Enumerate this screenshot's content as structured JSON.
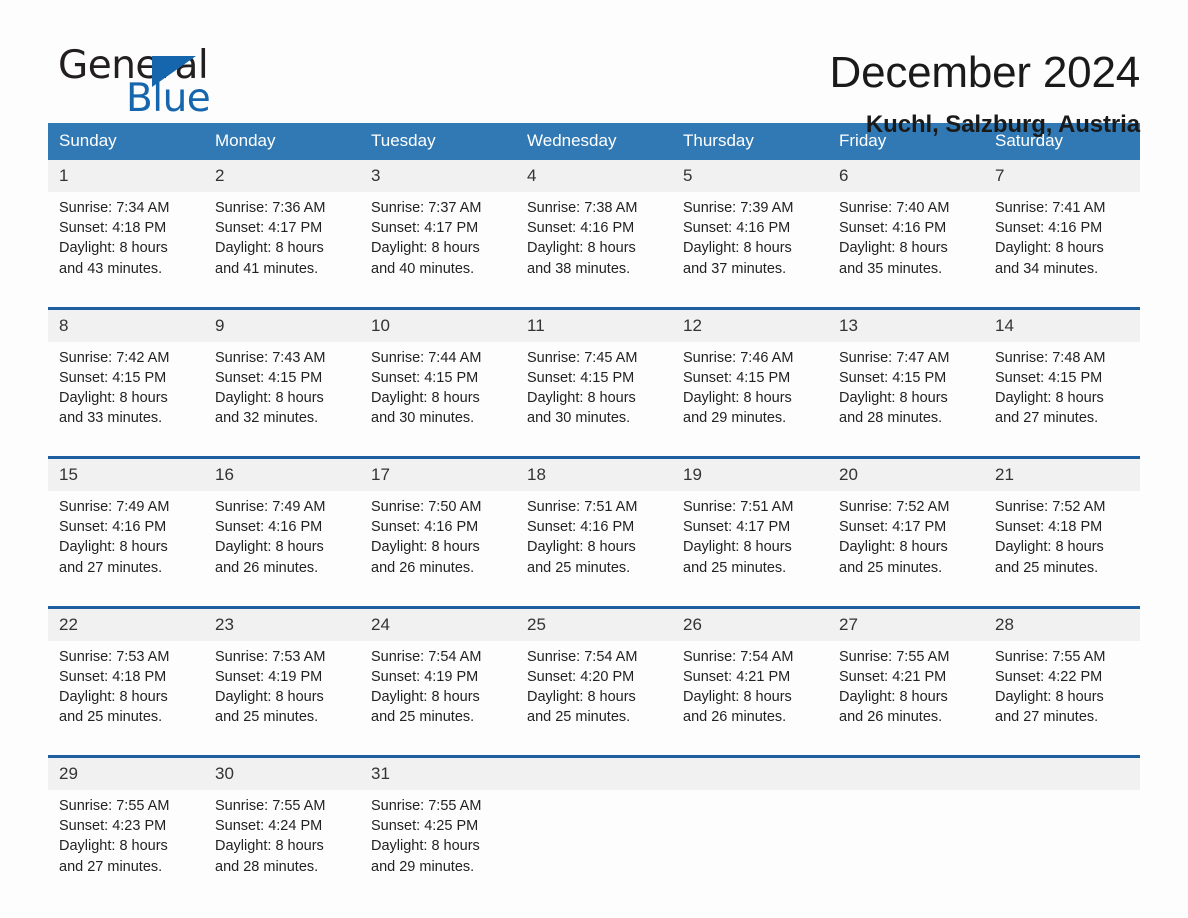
{
  "brand": {
    "name_part1": "General",
    "name_part2": "Blue"
  },
  "header": {
    "month_title": "December 2024",
    "location": "Kuchl, Salzburg, Austria"
  },
  "colors": {
    "header_blue": "#3079b5",
    "row_divider_blue": "#1f5fa0",
    "daynum_band": "#f1f1f1",
    "brand_blue": "#1566ad",
    "page_background": "#fdfdfd",
    "text": "#222222"
  },
  "weekdays": [
    "Sunday",
    "Monday",
    "Tuesday",
    "Wednesday",
    "Thursday",
    "Friday",
    "Saturday"
  ],
  "weeks": [
    [
      {
        "day": "1",
        "sunrise": "Sunrise: 7:34 AM",
        "sunset": "Sunset: 4:18 PM",
        "daylight_1": "Daylight: 8 hours",
        "daylight_2": "and 43 minutes."
      },
      {
        "day": "2",
        "sunrise": "Sunrise: 7:36 AM",
        "sunset": "Sunset: 4:17 PM",
        "daylight_1": "Daylight: 8 hours",
        "daylight_2": "and 41 minutes."
      },
      {
        "day": "3",
        "sunrise": "Sunrise: 7:37 AM",
        "sunset": "Sunset: 4:17 PM",
        "daylight_1": "Daylight: 8 hours",
        "daylight_2": "and 40 minutes."
      },
      {
        "day": "4",
        "sunrise": "Sunrise: 7:38 AM",
        "sunset": "Sunset: 4:16 PM",
        "daylight_1": "Daylight: 8 hours",
        "daylight_2": "and 38 minutes."
      },
      {
        "day": "5",
        "sunrise": "Sunrise: 7:39 AM",
        "sunset": "Sunset: 4:16 PM",
        "daylight_1": "Daylight: 8 hours",
        "daylight_2": "and 37 minutes."
      },
      {
        "day": "6",
        "sunrise": "Sunrise: 7:40 AM",
        "sunset": "Sunset: 4:16 PM",
        "daylight_1": "Daylight: 8 hours",
        "daylight_2": "and 35 minutes."
      },
      {
        "day": "7",
        "sunrise": "Sunrise: 7:41 AM",
        "sunset": "Sunset: 4:16 PM",
        "daylight_1": "Daylight: 8 hours",
        "daylight_2": "and 34 minutes."
      }
    ],
    [
      {
        "day": "8",
        "sunrise": "Sunrise: 7:42 AM",
        "sunset": "Sunset: 4:15 PM",
        "daylight_1": "Daylight: 8 hours",
        "daylight_2": "and 33 minutes."
      },
      {
        "day": "9",
        "sunrise": "Sunrise: 7:43 AM",
        "sunset": "Sunset: 4:15 PM",
        "daylight_1": "Daylight: 8 hours",
        "daylight_2": "and 32 minutes."
      },
      {
        "day": "10",
        "sunrise": "Sunrise: 7:44 AM",
        "sunset": "Sunset: 4:15 PM",
        "daylight_1": "Daylight: 8 hours",
        "daylight_2": "and 30 minutes."
      },
      {
        "day": "11",
        "sunrise": "Sunrise: 7:45 AM",
        "sunset": "Sunset: 4:15 PM",
        "daylight_1": "Daylight: 8 hours",
        "daylight_2": "and 30 minutes."
      },
      {
        "day": "12",
        "sunrise": "Sunrise: 7:46 AM",
        "sunset": "Sunset: 4:15 PM",
        "daylight_1": "Daylight: 8 hours",
        "daylight_2": "and 29 minutes."
      },
      {
        "day": "13",
        "sunrise": "Sunrise: 7:47 AM",
        "sunset": "Sunset: 4:15 PM",
        "daylight_1": "Daylight: 8 hours",
        "daylight_2": "and 28 minutes."
      },
      {
        "day": "14",
        "sunrise": "Sunrise: 7:48 AM",
        "sunset": "Sunset: 4:15 PM",
        "daylight_1": "Daylight: 8 hours",
        "daylight_2": "and 27 minutes."
      }
    ],
    [
      {
        "day": "15",
        "sunrise": "Sunrise: 7:49 AM",
        "sunset": "Sunset: 4:16 PM",
        "daylight_1": "Daylight: 8 hours",
        "daylight_2": "and 27 minutes."
      },
      {
        "day": "16",
        "sunrise": "Sunrise: 7:49 AM",
        "sunset": "Sunset: 4:16 PM",
        "daylight_1": "Daylight: 8 hours",
        "daylight_2": "and 26 minutes."
      },
      {
        "day": "17",
        "sunrise": "Sunrise: 7:50 AM",
        "sunset": "Sunset: 4:16 PM",
        "daylight_1": "Daylight: 8 hours",
        "daylight_2": "and 26 minutes."
      },
      {
        "day": "18",
        "sunrise": "Sunrise: 7:51 AM",
        "sunset": "Sunset: 4:16 PM",
        "daylight_1": "Daylight: 8 hours",
        "daylight_2": "and 25 minutes."
      },
      {
        "day": "19",
        "sunrise": "Sunrise: 7:51 AM",
        "sunset": "Sunset: 4:17 PM",
        "daylight_1": "Daylight: 8 hours",
        "daylight_2": "and 25 minutes."
      },
      {
        "day": "20",
        "sunrise": "Sunrise: 7:52 AM",
        "sunset": "Sunset: 4:17 PM",
        "daylight_1": "Daylight: 8 hours",
        "daylight_2": "and 25 minutes."
      },
      {
        "day": "21",
        "sunrise": "Sunrise: 7:52 AM",
        "sunset": "Sunset: 4:18 PM",
        "daylight_1": "Daylight: 8 hours",
        "daylight_2": "and 25 minutes."
      }
    ],
    [
      {
        "day": "22",
        "sunrise": "Sunrise: 7:53 AM",
        "sunset": "Sunset: 4:18 PM",
        "daylight_1": "Daylight: 8 hours",
        "daylight_2": "and 25 minutes."
      },
      {
        "day": "23",
        "sunrise": "Sunrise: 7:53 AM",
        "sunset": "Sunset: 4:19 PM",
        "daylight_1": "Daylight: 8 hours",
        "daylight_2": "and 25 minutes."
      },
      {
        "day": "24",
        "sunrise": "Sunrise: 7:54 AM",
        "sunset": "Sunset: 4:19 PM",
        "daylight_1": "Daylight: 8 hours",
        "daylight_2": "and 25 minutes."
      },
      {
        "day": "25",
        "sunrise": "Sunrise: 7:54 AM",
        "sunset": "Sunset: 4:20 PM",
        "daylight_1": "Daylight: 8 hours",
        "daylight_2": "and 25 minutes."
      },
      {
        "day": "26",
        "sunrise": "Sunrise: 7:54 AM",
        "sunset": "Sunset: 4:21 PM",
        "daylight_1": "Daylight: 8 hours",
        "daylight_2": "and 26 minutes."
      },
      {
        "day": "27",
        "sunrise": "Sunrise: 7:55 AM",
        "sunset": "Sunset: 4:21 PM",
        "daylight_1": "Daylight: 8 hours",
        "daylight_2": "and 26 minutes."
      },
      {
        "day": "28",
        "sunrise": "Sunrise: 7:55 AM",
        "sunset": "Sunset: 4:22 PM",
        "daylight_1": "Daylight: 8 hours",
        "daylight_2": "and 27 minutes."
      }
    ],
    [
      {
        "day": "29",
        "sunrise": "Sunrise: 7:55 AM",
        "sunset": "Sunset: 4:23 PM",
        "daylight_1": "Daylight: 8 hours",
        "daylight_2": "and 27 minutes."
      },
      {
        "day": "30",
        "sunrise": "Sunrise: 7:55 AM",
        "sunset": "Sunset: 4:24 PM",
        "daylight_1": "Daylight: 8 hours",
        "daylight_2": "and 28 minutes."
      },
      {
        "day": "31",
        "sunrise": "Sunrise: 7:55 AM",
        "sunset": "Sunset: 4:25 PM",
        "daylight_1": "Daylight: 8 hours",
        "daylight_2": "and 29 minutes."
      },
      {
        "day": "",
        "sunrise": "",
        "sunset": "",
        "daylight_1": "",
        "daylight_2": ""
      },
      {
        "day": "",
        "sunrise": "",
        "sunset": "",
        "daylight_1": "",
        "daylight_2": ""
      },
      {
        "day": "",
        "sunrise": "",
        "sunset": "",
        "daylight_1": "",
        "daylight_2": ""
      },
      {
        "day": "",
        "sunrise": "",
        "sunset": "",
        "daylight_1": "",
        "daylight_2": ""
      }
    ]
  ]
}
